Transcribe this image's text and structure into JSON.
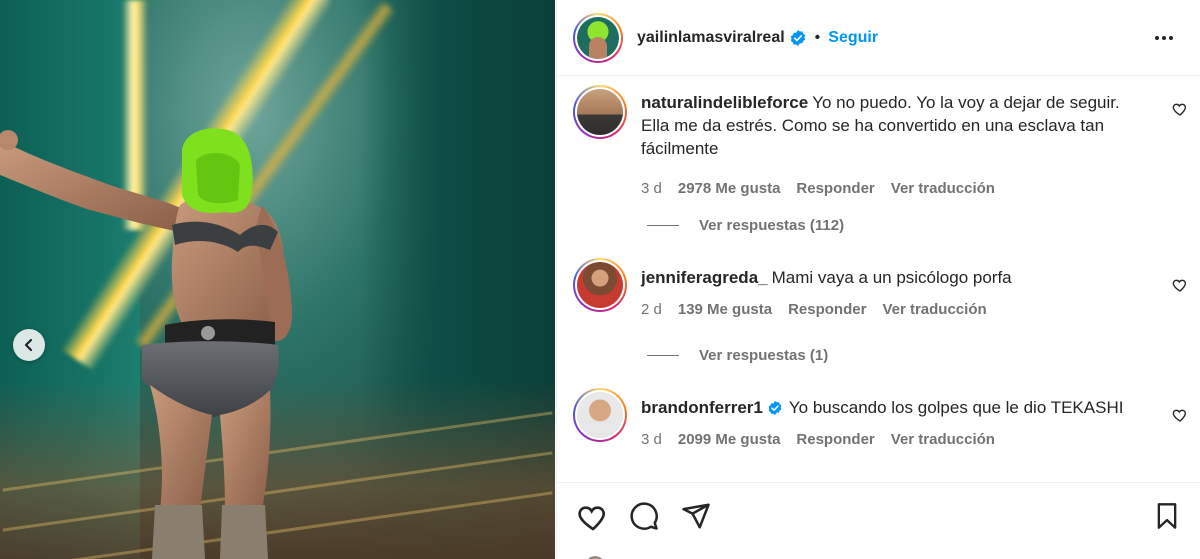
{
  "post": {
    "username": "yailinlamasviralreal",
    "verified": true,
    "separator": "•",
    "follow_label": "Seguir",
    "more_icon": "more-options-icon"
  },
  "comments": [
    {
      "username": "naturalindelibleforce",
      "verified": false,
      "text": "Yo no puedo. Yo la voy a dejar de seguir. Ella me da estrés. Como se ha convertido en una esclava tan fácilmente",
      "time": "3 d",
      "likes": "2978 Me gusta",
      "reply_label": "Responder",
      "translate_label": "Ver traducción",
      "view_replies": "Ver respuestas (112)"
    },
    {
      "username": "jenniferagreda_",
      "verified": false,
      "text": "Mami vaya a un psicólogo porfa",
      "time": "2 d",
      "likes": "139 Me gusta",
      "reply_label": "Responder",
      "translate_label": "Ver traducción",
      "view_replies": "Ver respuestas (1)"
    },
    {
      "username": "brandonferrer1",
      "verified": true,
      "text": "Yo buscando los golpes que le dio TEKASHI",
      "time": "3 d",
      "likes": "2099 Me gusta",
      "reply_label": "Responder",
      "translate_label": "Ver traducción"
    }
  ],
  "actions": {
    "like_icon": "heart-icon",
    "comment_icon": "comment-icon",
    "share_icon": "share-icon",
    "save_icon": "bookmark-icon"
  },
  "colors": {
    "accent": "#0095f6",
    "verified": "#0095f6",
    "secondary_text": "#737373",
    "primary_text": "#262626"
  }
}
